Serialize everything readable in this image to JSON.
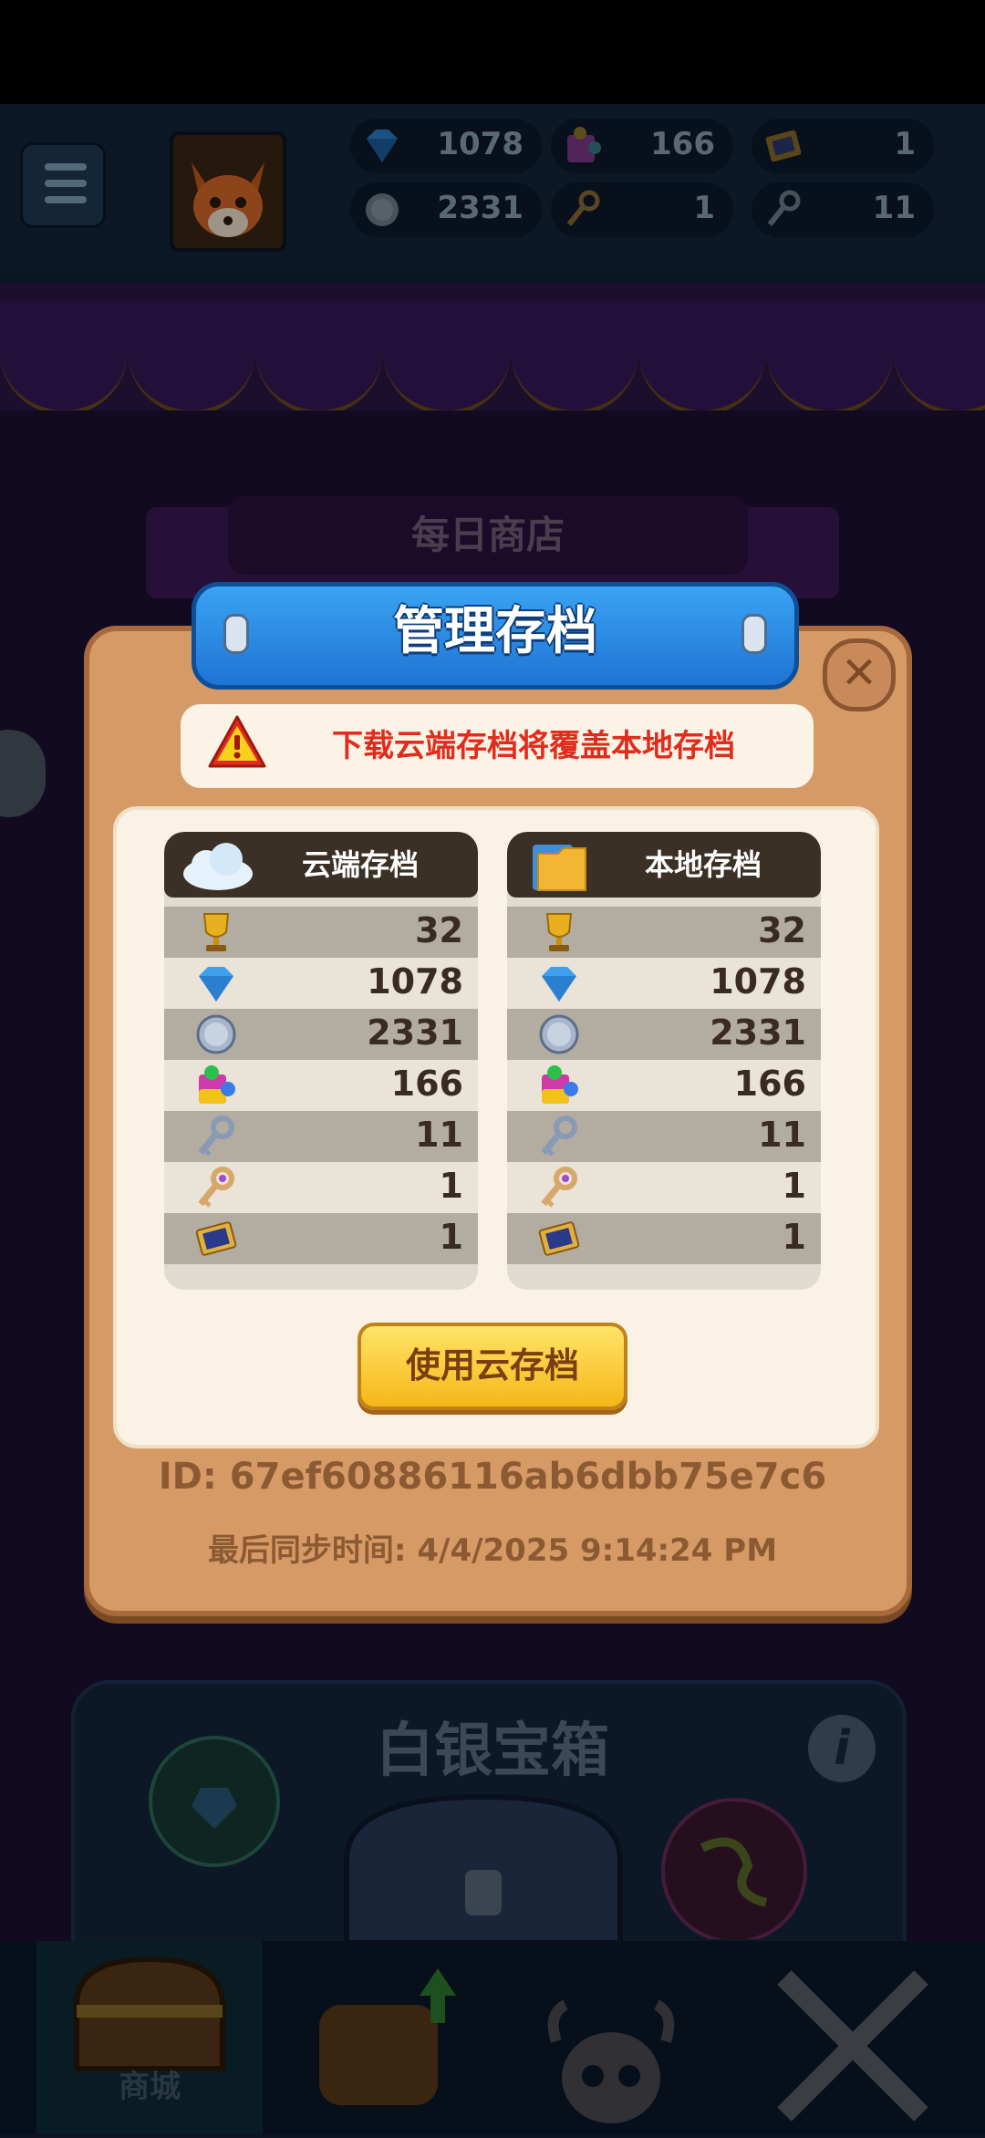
{
  "header": {
    "currencies": {
      "diamonds": "1078",
      "puzzle_pieces": "166",
      "tickets": "1",
      "silver_coins": "2331",
      "gold_keys": "1",
      "silver_keys": "11"
    }
  },
  "background": {
    "daily_shop_title": "每日商店",
    "chest_title": "白银宝箱",
    "info_label": "i",
    "nav_shop_label": "商城"
  },
  "modal": {
    "title": "管理存档",
    "close_label": "✕",
    "warning": "下载云端存档将覆盖本地存档",
    "cloud": {
      "title": "云端存档",
      "values": [
        "32",
        "1078",
        "2331",
        "166",
        "11",
        "1",
        "1"
      ]
    },
    "local": {
      "title": "本地存档",
      "values": [
        "32",
        "1078",
        "2331",
        "166",
        "11",
        "1",
        "1"
      ]
    },
    "row_icons": [
      "trophy-icon",
      "diamond-icon",
      "silver-coin-icon",
      "puzzle-piece-icon",
      "silver-key-icon",
      "gold-key-icon",
      "ticket-icon"
    ],
    "use_cloud_button": "使用云存档",
    "save_id": "ID: 67ef60886116ab6dbb75e7c6",
    "last_sync": "最后同步时间: 4/4/2025 9:14:24 PM"
  },
  "colors": {
    "modal_wood": "#d69a66",
    "header_blue": "#1f74d4",
    "warning_red": "#e02c1c",
    "button_yellow": "#f5b718"
  }
}
